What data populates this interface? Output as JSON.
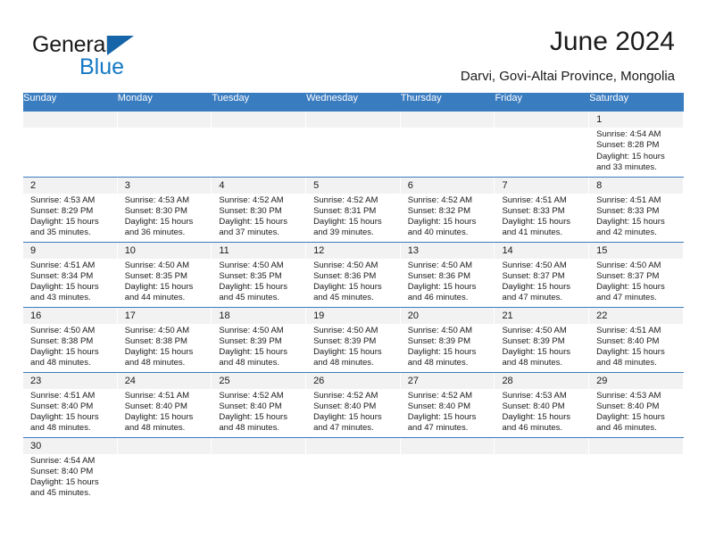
{
  "brand": {
    "name_top": "General",
    "name_bottom": "Blue",
    "accent_color": "#1579c4",
    "triangle_color": "#1565a8"
  },
  "header": {
    "title": "June 2024",
    "subtitle": "Darvi, Govi-Altai Province, Mongolia"
  },
  "theme": {
    "header_row_color": "#3a7cc0",
    "day_number_bar_color": "#f2f2f2",
    "grid_line_color": "#3a7cc0",
    "text_color": "#1a1a1a"
  },
  "calendar": {
    "month": "June",
    "year": "2024",
    "weekday_headers": [
      "Sunday",
      "Monday",
      "Tuesday",
      "Wednesday",
      "Thursday",
      "Friday",
      "Saturday"
    ],
    "weeks": [
      [
        {
          "day": "",
          "empty": true
        },
        {
          "day": "",
          "empty": true
        },
        {
          "day": "",
          "empty": true
        },
        {
          "day": "",
          "empty": true
        },
        {
          "day": "",
          "empty": true
        },
        {
          "day": "",
          "empty": true
        },
        {
          "day": "1",
          "sunrise": "Sunrise: 4:54 AM",
          "sunset": "Sunset: 8:28 PM",
          "daylight": "Daylight: 15 hours and 33 minutes."
        }
      ],
      [
        {
          "day": "2",
          "sunrise": "Sunrise: 4:53 AM",
          "sunset": "Sunset: 8:29 PM",
          "daylight": "Daylight: 15 hours and 35 minutes."
        },
        {
          "day": "3",
          "sunrise": "Sunrise: 4:53 AM",
          "sunset": "Sunset: 8:30 PM",
          "daylight": "Daylight: 15 hours and 36 minutes."
        },
        {
          "day": "4",
          "sunrise": "Sunrise: 4:52 AM",
          "sunset": "Sunset: 8:30 PM",
          "daylight": "Daylight: 15 hours and 37 minutes."
        },
        {
          "day": "5",
          "sunrise": "Sunrise: 4:52 AM",
          "sunset": "Sunset: 8:31 PM",
          "daylight": "Daylight: 15 hours and 39 minutes."
        },
        {
          "day": "6",
          "sunrise": "Sunrise: 4:52 AM",
          "sunset": "Sunset: 8:32 PM",
          "daylight": "Daylight: 15 hours and 40 minutes."
        },
        {
          "day": "7",
          "sunrise": "Sunrise: 4:51 AM",
          "sunset": "Sunset: 8:33 PM",
          "daylight": "Daylight: 15 hours and 41 minutes."
        },
        {
          "day": "8",
          "sunrise": "Sunrise: 4:51 AM",
          "sunset": "Sunset: 8:33 PM",
          "daylight": "Daylight: 15 hours and 42 minutes."
        }
      ],
      [
        {
          "day": "9",
          "sunrise": "Sunrise: 4:51 AM",
          "sunset": "Sunset: 8:34 PM",
          "daylight": "Daylight: 15 hours and 43 minutes."
        },
        {
          "day": "10",
          "sunrise": "Sunrise: 4:50 AM",
          "sunset": "Sunset: 8:35 PM",
          "daylight": "Daylight: 15 hours and 44 minutes."
        },
        {
          "day": "11",
          "sunrise": "Sunrise: 4:50 AM",
          "sunset": "Sunset: 8:35 PM",
          "daylight": "Daylight: 15 hours and 45 minutes."
        },
        {
          "day": "12",
          "sunrise": "Sunrise: 4:50 AM",
          "sunset": "Sunset: 8:36 PM",
          "daylight": "Daylight: 15 hours and 45 minutes."
        },
        {
          "day": "13",
          "sunrise": "Sunrise: 4:50 AM",
          "sunset": "Sunset: 8:36 PM",
          "daylight": "Daylight: 15 hours and 46 minutes."
        },
        {
          "day": "14",
          "sunrise": "Sunrise: 4:50 AM",
          "sunset": "Sunset: 8:37 PM",
          "daylight": "Daylight: 15 hours and 47 minutes."
        },
        {
          "day": "15",
          "sunrise": "Sunrise: 4:50 AM",
          "sunset": "Sunset: 8:37 PM",
          "daylight": "Daylight: 15 hours and 47 minutes."
        }
      ],
      [
        {
          "day": "16",
          "sunrise": "Sunrise: 4:50 AM",
          "sunset": "Sunset: 8:38 PM",
          "daylight": "Daylight: 15 hours and 48 minutes."
        },
        {
          "day": "17",
          "sunrise": "Sunrise: 4:50 AM",
          "sunset": "Sunset: 8:38 PM",
          "daylight": "Daylight: 15 hours and 48 minutes."
        },
        {
          "day": "18",
          "sunrise": "Sunrise: 4:50 AM",
          "sunset": "Sunset: 8:39 PM",
          "daylight": "Daylight: 15 hours and 48 minutes."
        },
        {
          "day": "19",
          "sunrise": "Sunrise: 4:50 AM",
          "sunset": "Sunset: 8:39 PM",
          "daylight": "Daylight: 15 hours and 48 minutes."
        },
        {
          "day": "20",
          "sunrise": "Sunrise: 4:50 AM",
          "sunset": "Sunset: 8:39 PM",
          "daylight": "Daylight: 15 hours and 48 minutes."
        },
        {
          "day": "21",
          "sunrise": "Sunrise: 4:50 AM",
          "sunset": "Sunset: 8:39 PM",
          "daylight": "Daylight: 15 hours and 48 minutes."
        },
        {
          "day": "22",
          "sunrise": "Sunrise: 4:51 AM",
          "sunset": "Sunset: 8:40 PM",
          "daylight": "Daylight: 15 hours and 48 minutes."
        }
      ],
      [
        {
          "day": "23",
          "sunrise": "Sunrise: 4:51 AM",
          "sunset": "Sunset: 8:40 PM",
          "daylight": "Daylight: 15 hours and 48 minutes."
        },
        {
          "day": "24",
          "sunrise": "Sunrise: 4:51 AM",
          "sunset": "Sunset: 8:40 PM",
          "daylight": "Daylight: 15 hours and 48 minutes."
        },
        {
          "day": "25",
          "sunrise": "Sunrise: 4:52 AM",
          "sunset": "Sunset: 8:40 PM",
          "daylight": "Daylight: 15 hours and 48 minutes."
        },
        {
          "day": "26",
          "sunrise": "Sunrise: 4:52 AM",
          "sunset": "Sunset: 8:40 PM",
          "daylight": "Daylight: 15 hours and 47 minutes."
        },
        {
          "day": "27",
          "sunrise": "Sunrise: 4:52 AM",
          "sunset": "Sunset: 8:40 PM",
          "daylight": "Daylight: 15 hours and 47 minutes."
        },
        {
          "day": "28",
          "sunrise": "Sunrise: 4:53 AM",
          "sunset": "Sunset: 8:40 PM",
          "daylight": "Daylight: 15 hours and 46 minutes."
        },
        {
          "day": "29",
          "sunrise": "Sunrise: 4:53 AM",
          "sunset": "Sunset: 8:40 PM",
          "daylight": "Daylight: 15 hours and 46 minutes."
        }
      ],
      [
        {
          "day": "30",
          "sunrise": "Sunrise: 4:54 AM",
          "sunset": "Sunset: 8:40 PM",
          "daylight": "Daylight: 15 hours and 45 minutes."
        },
        {
          "day": "",
          "empty": true
        },
        {
          "day": "",
          "empty": true
        },
        {
          "day": "",
          "empty": true
        },
        {
          "day": "",
          "empty": true
        },
        {
          "day": "",
          "empty": true
        },
        {
          "day": "",
          "empty": true
        }
      ]
    ]
  }
}
